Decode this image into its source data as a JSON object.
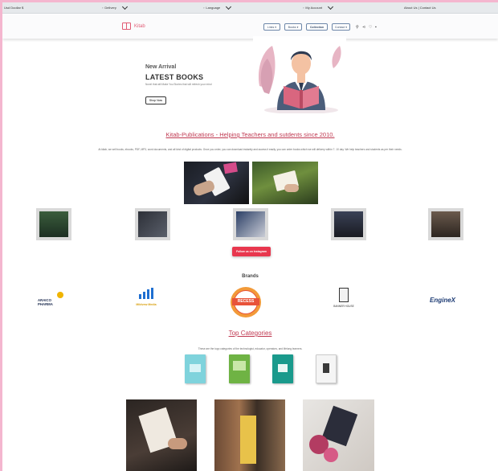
{
  "topbar": {
    "currency": "Usd Doollar $",
    "items": [
      "Delivery",
      "Language",
      "My Account"
    ],
    "right_links": "About Us | Contact Us"
  },
  "nav": {
    "brand": "Kitab",
    "buttons": [
      "Links",
      "Books",
      "Collection",
      "Contact"
    ]
  },
  "hero": {
    "subtitle": "New Arrival",
    "title": "LATEST BOOKS",
    "text": "Novel that will Make You Stories that will refresh your mind",
    "button": "Shop Now"
  },
  "headline": "Kitab-Publications - Helping Teachers and sutdents since 2010.",
  "description": "At kitab, we sell books, ebooks, PDF, MP3, word documents, and all kind of digital products. Once you order, you can download instantly and access it easily, you can order books which we will delivery within 7- 10 day. We help teachers and students as per their needs.",
  "instagram_button": "Follow us on Instagram",
  "brands": {
    "title": "Brands",
    "items": [
      "ARAICO PHARMA",
      "Mildvew Media",
      "RECESS",
      "BANNER HOUSE",
      "EngineX"
    ]
  },
  "categories": {
    "title": "Top Categories",
    "text": "These are the topp categories of the technologist, educator, operators, and lifelong learners."
  },
  "colors": {
    "accent": "#e15b74",
    "link": "#c03a52",
    "instagram": "#e8374e",
    "background": "#f4b6cf"
  }
}
